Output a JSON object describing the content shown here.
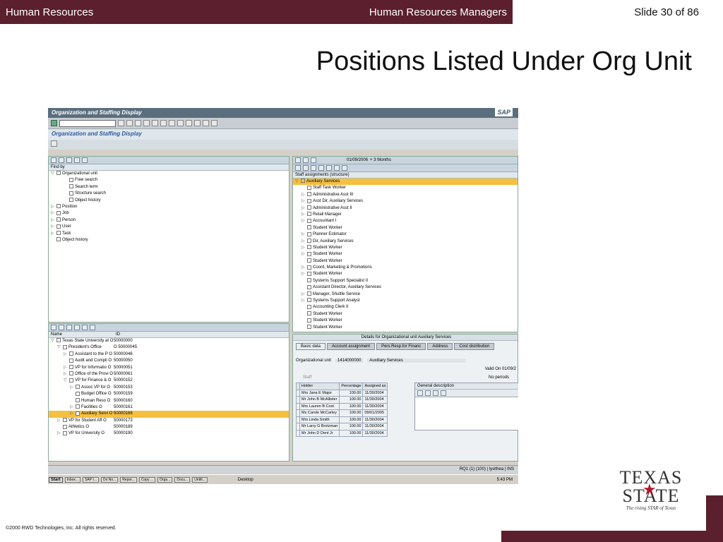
{
  "header": {
    "left": "Human Resources",
    "center": "Human Resources Managers",
    "slide": "Slide 30 of 86"
  },
  "title": "Positions Listed Under Org Unit",
  "copyright": "©2000 RWD Technologies, Inc.  All rights reserved.",
  "logo": {
    "line1": "TEXAS",
    "line2": "STATE",
    "tagline": "The rising STAR of Texas"
  },
  "sap": {
    "window_title": "Organization and Staffing Display",
    "logo": "SAP",
    "subtitle": "Organization and Staffing Display",
    "findby": {
      "header": "Find by",
      "items": [
        {
          "label": "Organizational unit",
          "indent": 0,
          "tri": "▽"
        },
        {
          "label": "Free search",
          "indent": 2,
          "tri": ""
        },
        {
          "label": "Search term",
          "indent": 2,
          "tri": ""
        },
        {
          "label": "Structure search",
          "indent": 2,
          "tri": ""
        },
        {
          "label": "Object history",
          "indent": 2,
          "tri": ""
        },
        {
          "label": "Position",
          "indent": 0,
          "tri": "▷"
        },
        {
          "label": "Job",
          "indent": 0,
          "tri": "▷"
        },
        {
          "label": "Person",
          "indent": 0,
          "tri": "▷"
        },
        {
          "label": "User",
          "indent": 0,
          "tri": "▷"
        },
        {
          "label": "Task",
          "indent": 0,
          "tri": "▷"
        },
        {
          "label": "Object history",
          "indent": 0,
          "tri": ""
        }
      ]
    },
    "orgtree": {
      "col_name": "Name",
      "col_id": "ID",
      "rows": [
        {
          "name": "Texas State University at O",
          "id": "50000000",
          "indent": 0,
          "tri": "▽"
        },
        {
          "name": "President's Office",
          "id": "O 50000045",
          "indent": 1,
          "tri": "▽"
        },
        {
          "name": "Assistant to the P O",
          "id": "50000046",
          "indent": 2,
          "tri": "▷"
        },
        {
          "name": "Audit and Compli O",
          "id": "50000050",
          "indent": 2,
          "tri": ""
        },
        {
          "name": "VP for Informatio O",
          "id": "50000051",
          "indent": 2,
          "tri": "▷"
        },
        {
          "name": "Office of the Provi O",
          "id": "50000061",
          "indent": 2,
          "tri": "▷"
        },
        {
          "name": "VP for Finance & O",
          "id": "50000152",
          "indent": 2,
          "tri": "▽"
        },
        {
          "name": "Assoc VP for O",
          "id": "50000153",
          "indent": 3,
          "tri": "▷"
        },
        {
          "name": "Budget Office O",
          "id": "50000159",
          "indent": 3,
          "tri": ""
        },
        {
          "name": "Human Reso O",
          "id": "50000160",
          "indent": 3,
          "tri": ""
        },
        {
          "name": "Facilities O",
          "id": "50000161",
          "indent": 3,
          "tri": "▷"
        },
        {
          "name": "Auxiliary Servi O",
          "id": "50000168",
          "indent": 3,
          "tri": "▷"
        },
        {
          "name": "VP for Student Aff O",
          "id": "50000173",
          "indent": 1,
          "tri": "▷"
        },
        {
          "name": "Athletics O",
          "id": "50000189",
          "indent": 1,
          "tri": ""
        },
        {
          "name": "VP for University O",
          "id": "50000190",
          "indent": 1,
          "tri": "▷"
        }
      ]
    },
    "right_toolbar": {
      "date": "01/09/2006",
      "period": "+ 3 Months"
    },
    "staff": {
      "header": "Staff assignments (structure)",
      "rows": [
        {
          "label": "Auxiliary Services",
          "tri": "▽",
          "indent": 0
        },
        {
          "label": "Staff Task Worker",
          "tri": "",
          "indent": 1
        },
        {
          "label": "Administrative Asst III",
          "tri": "▷",
          "indent": 1
        },
        {
          "label": "Asst Dir, Auxiliary Services",
          "tri": "▷",
          "indent": 1
        },
        {
          "label": "Administrative Asst II",
          "tri": "▷",
          "indent": 1
        },
        {
          "label": "Retail Manager",
          "tri": "▷",
          "indent": 1
        },
        {
          "label": "Accountant I",
          "tri": "▷",
          "indent": 1
        },
        {
          "label": "Student Worker",
          "tri": "",
          "indent": 1
        },
        {
          "label": "Planner Estimator",
          "tri": "▷",
          "indent": 1
        },
        {
          "label": "Dir, Auxiliary Services",
          "tri": "▷",
          "indent": 1
        },
        {
          "label": "Student Worker",
          "tri": "▷",
          "indent": 1
        },
        {
          "label": "Student Worker",
          "tri": "▷",
          "indent": 1
        },
        {
          "label": "Student Worker",
          "tri": "",
          "indent": 1
        },
        {
          "label": "Coord, Marketing & Promotions",
          "tri": "▷",
          "indent": 1
        },
        {
          "label": "Student Worker",
          "tri": "▷",
          "indent": 1
        },
        {
          "label": "Systems Support Specialist II",
          "tri": "",
          "indent": 1
        },
        {
          "label": "Assistant Director, Auxiliary Services",
          "tri": "",
          "indent": 1
        },
        {
          "label": "Manager, Shuttle Service",
          "tri": "▷",
          "indent": 1
        },
        {
          "label": "Systems Support Analyst",
          "tri": "▷",
          "indent": 1
        },
        {
          "label": "Accounting Clerk II",
          "tri": "",
          "indent": 1
        },
        {
          "label": "Student Worker",
          "tri": "",
          "indent": 1
        },
        {
          "label": "Student Worker",
          "tri": "",
          "indent": 1
        },
        {
          "label": "Student Worker",
          "tri": "",
          "indent": 1
        }
      ]
    },
    "details": {
      "title": "Details for Organizational unit Auxiliary Services",
      "tabs": [
        "Basic data",
        "Account assignment",
        "Pers.Resp.for Financ",
        "Address",
        "Cost distribution"
      ],
      "orgunit_label": "Organizational unit",
      "orgunit_id": "1414000000",
      "orgunit_name": "Auxiliary Services",
      "valid_on_label": "Valid On",
      "valid_on": "01/09/2",
      "no_periods": "No periods",
      "staff_label": "Staff",
      "general_desc": "General description",
      "table_headers": [
        "Holder",
        "Percentage",
        "Assigned as"
      ],
      "holders": [
        [
          "Mrs Jana E Major",
          "100.00",
          "11/30/2004"
        ],
        [
          "Mr John B McAllister",
          "100.00",
          "11/30/2004"
        ],
        [
          "Mrs Lauren B Cost",
          "100.00",
          "11/30/2004"
        ],
        [
          "Ms Carole McCarley",
          "100.00",
          "09/01/2005"
        ],
        [
          "Mrs Linda Smith",
          "100.00",
          "11/30/2004"
        ],
        [
          "Mr Larry G Brotzman",
          "100.00",
          "11/30/2004"
        ],
        [
          "Mr John D Dent Jr",
          "100.00",
          "11/30/2004"
        ]
      ]
    },
    "status": {
      "system": "RQ1 (1) (100)",
      "user": "lysithea",
      "mode": "INS"
    },
    "taskbar": {
      "start": "Start",
      "buttons": [
        "Inbox...",
        "SAP I...",
        "Do No...",
        "Repor...",
        "Copy ...",
        "Orga...",
        "Docu...",
        "Untitl..."
      ],
      "desktop": "Desktop",
      "time": "5:43 PM"
    }
  }
}
